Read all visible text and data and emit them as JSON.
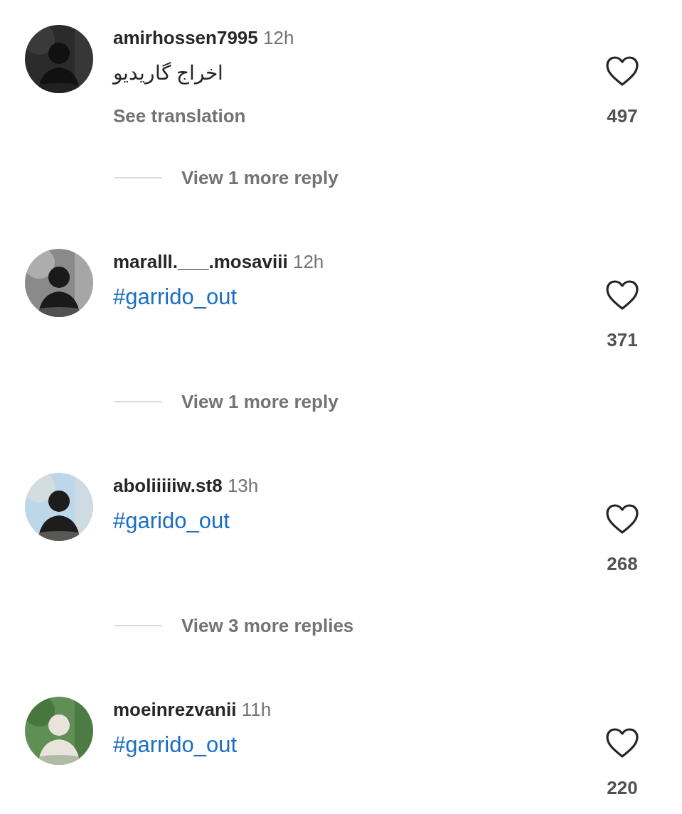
{
  "comments": [
    {
      "username": "amirhossen7995",
      "time": "12h",
      "text": "اخراج گاریدیو",
      "kind": "text",
      "translation": "See translation",
      "likes": "497",
      "replies": "View 1 more reply"
    },
    {
      "username": "maralll.___.mosaviii",
      "time": "12h",
      "text": "#garrido_out",
      "kind": "hashtag",
      "likes": "371",
      "replies": "View 1 more reply"
    },
    {
      "username": "aboliiiiiw.st8",
      "time": "13h",
      "text": "#garido_out",
      "kind": "hashtag",
      "likes": "268",
      "replies": "View 3 more replies"
    },
    {
      "username": "moeinrezvanii",
      "time": "11h",
      "text": "#garrido_out",
      "kind": "hashtag",
      "likes": "220"
    }
  ]
}
